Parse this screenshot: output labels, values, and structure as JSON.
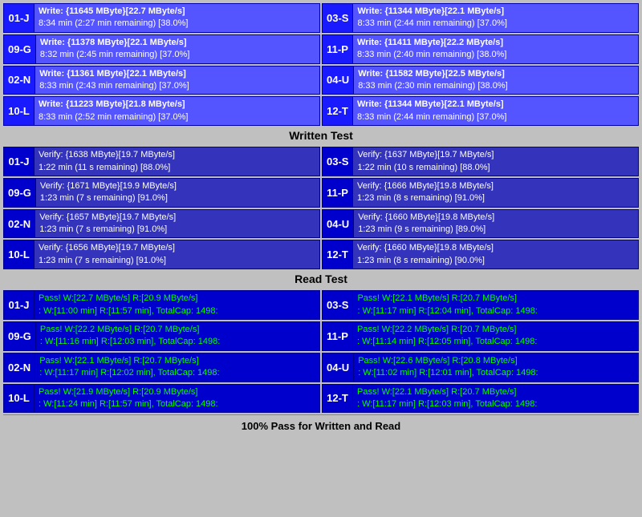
{
  "sections": {
    "write": {
      "header": "Written Test",
      "devices": [
        {
          "id": "01-J",
          "line1": "Write: {11645 MByte}[22.7 MByte/s]",
          "line2": "8:34 min (2:27 min remaining)  [38.0%]"
        },
        {
          "id": "09-G",
          "line1": "Write: {11378 MByte}[22.1 MByte/s]",
          "line2": "8:32 min (2:45 min remaining)  [37.0%]"
        },
        {
          "id": "02-N",
          "line1": "Write: {11361 MByte}[22.1 MByte/s]",
          "line2": "8:33 min (2:43 min remaining)  [37.0%]"
        },
        {
          "id": "10-L",
          "line1": "Write: {11223 MByte}[21.8 MByte/s]",
          "line2": "8:33 min (2:52 min remaining)  [37.0%]"
        },
        {
          "id": "03-S",
          "line1": "Write: {11344 MByte}[22.1 MByte/s]",
          "line2": "8:33 min (2:44 min remaining)  [37.0%]"
        },
        {
          "id": "11-P",
          "line1": "Write: {11411 MByte}[22.2 MByte/s]",
          "line2": "8:33 min (2:40 min remaining)  [38.0%]"
        },
        {
          "id": "04-U",
          "line1": "Write: {11582 MByte}[22.5 MByte/s]",
          "line2": "8:33 min (2:30 min remaining)  [38.0%]"
        },
        {
          "id": "12-T",
          "line1": "Write: {11344 MByte}[22.1 MByte/s]",
          "line2": "8:33 min (2:44 min remaining)  [37.0%]"
        }
      ]
    },
    "verify": {
      "header": "Written Test",
      "devices": [
        {
          "id": "01-J",
          "line1": "Verify: {1638 MByte}[19.7 MByte/s]",
          "line2": "1:22 min (11 s remaining)   [88.0%]"
        },
        {
          "id": "09-G",
          "line1": "Verify: {1671 MByte}[19.9 MByte/s]",
          "line2": "1:23 min (7 s remaining)   [91.0%]"
        },
        {
          "id": "02-N",
          "line1": "Verify: {1657 MByte}[19.7 MByte/s]",
          "line2": "1:23 min (7 s remaining)   [91.0%]"
        },
        {
          "id": "10-L",
          "line1": "Verify: {1656 MByte}[19.7 MByte/s]",
          "line2": "1:23 min (7 s remaining)   [91.0%]"
        },
        {
          "id": "03-S",
          "line1": "Verify: {1637 MByte}[19.7 MByte/s]",
          "line2": "1:22 min (10 s remaining)   [88.0%]"
        },
        {
          "id": "11-P",
          "line1": "Verify: {1666 MByte}[19.8 MByte/s]",
          "line2": "1:23 min (8 s remaining)   [91.0%]"
        },
        {
          "id": "04-U",
          "line1": "Verify: {1660 MByte}[19.8 MByte/s]",
          "line2": "1:23 min (9 s remaining)   [89.0%]"
        },
        {
          "id": "12-T",
          "line1": "Verify: {1660 MByte}[19.8 MByte/s]",
          "line2": "1:23 min (8 s remaining)   [90.0%]"
        }
      ]
    },
    "read": {
      "header": "Read Test",
      "devices": [
        {
          "id": "01-J",
          "line1": "Pass! W:[22.7 MByte/s] R:[20.9 MByte/s]",
          "line2": ": W:[11:00 min] R:[11:57 min], TotalCap: 1498:"
        },
        {
          "id": "09-G",
          "line1": "Pass! W:[22.2 MByte/s] R:[20.7 MByte/s]",
          "line2": ": W:[11:16 min] R:[12:03 min], TotalCap: 1498:"
        },
        {
          "id": "02-N",
          "line1": "Pass! W:[22.1 MByte/s] R:[20.7 MByte/s]",
          "line2": ": W:[11:17 min] R:[12:02 min], TotalCap: 1498:"
        },
        {
          "id": "10-L",
          "line1": "Pass! W:[21.9 MByte/s] R:[20.9 MByte/s]",
          "line2": ": W:[11:24 min] R:[11:57 min], TotalCap: 1498:"
        },
        {
          "id": "03-S",
          "line1": "Pass! W:[22.1 MByte/s] R:[20.7 MByte/s]",
          "line2": ": W:[11:17 min] R:[12:04 min], TotalCap: 1498:"
        },
        {
          "id": "11-P",
          "line1": "Pass! W:[22.2 MByte/s] R:[20.7 MByte/s]",
          "line2": ": W:[11:14 min] R:[12:05 min], TotalCap: 1498:"
        },
        {
          "id": "04-U",
          "line1": "Pass! W:[22.6 MByte/s] R:[20.8 MByte/s]",
          "line2": ": W:[11:02 min] R:[12:01 min], TotalCap: 1498:"
        },
        {
          "id": "12-T",
          "line1": "Pass! W:[22.1 MByte/s] R:[20.7 MByte/s]",
          "line2": ": W:[11:17 min] R:[12:03 min], TotalCap: 1498:"
        }
      ]
    }
  },
  "footer": "100% Pass for Written and Read",
  "headers": {
    "written_test": "Written Test",
    "read_test": "Read Test"
  }
}
